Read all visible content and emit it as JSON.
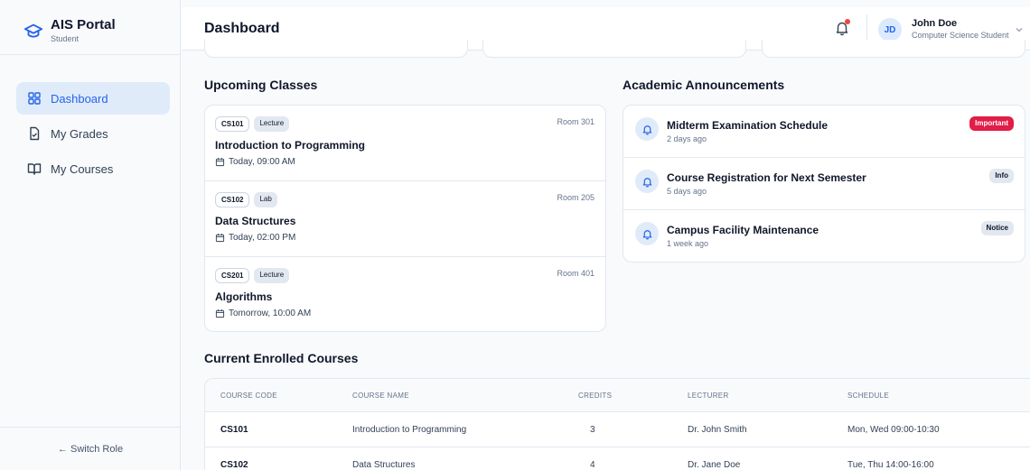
{
  "brand": {
    "title": "AIS Portal",
    "subtitle": "Student"
  },
  "nav": {
    "items": [
      {
        "label": "Dashboard",
        "icon": "grid-icon",
        "active": true
      },
      {
        "label": "My Grades",
        "icon": "file-check-icon",
        "active": false
      },
      {
        "label": "My Courses",
        "icon": "book-open-icon",
        "active": false
      }
    ],
    "switch_role": "← Switch Role"
  },
  "header": {
    "title": "Dashboard",
    "user": {
      "initials": "JD",
      "name": "John Doe",
      "role": "Computer Science Student"
    }
  },
  "upcoming": {
    "title": "Upcoming Classes",
    "items": [
      {
        "code": "CS101",
        "type": "Lecture",
        "room": "Room 301",
        "name": "Introduction to Programming",
        "time": "Today, 09:00 AM"
      },
      {
        "code": "CS102",
        "type": "Lab",
        "room": "Room 205",
        "name": "Data Structures",
        "time": "Today, 02:00 PM"
      },
      {
        "code": "CS201",
        "type": "Lecture",
        "room": "Room 401",
        "name": "Algorithms",
        "time": "Tomorrow, 10:00 AM"
      }
    ]
  },
  "announcements": {
    "title": "Academic Announcements",
    "items": [
      {
        "title": "Midterm Examination Schedule",
        "time": "2 days ago",
        "badge": "Important",
        "badge_color": "#e11d48"
      },
      {
        "title": "Course Registration for Next Semester",
        "time": "5 days ago",
        "badge": "Info",
        "badge_color": "#e2e8f0"
      },
      {
        "title": "Campus Facility Maintenance",
        "time": "1 week ago",
        "badge": "Notice",
        "badge_color": "#e2e8f0"
      }
    ]
  },
  "courses": {
    "title": "Current Enrolled Courses",
    "columns": [
      "COURSE CODE",
      "COURSE NAME",
      "CREDITS",
      "LECTURER",
      "SCHEDULE"
    ],
    "rows": [
      [
        "CS101",
        "Introduction to Programming",
        "3",
        "Dr. John Smith",
        "Mon, Wed 09:00-10:30"
      ],
      [
        "CS102",
        "Data Structures",
        "4",
        "Dr. Jane Doe",
        "Tue, Thu 14:00-16:00"
      ]
    ]
  },
  "colors": {
    "accent": "#2563eb",
    "active_bg": "#e0ebfa",
    "danger": "#e11d48",
    "notification_dot": "#ef4444"
  }
}
